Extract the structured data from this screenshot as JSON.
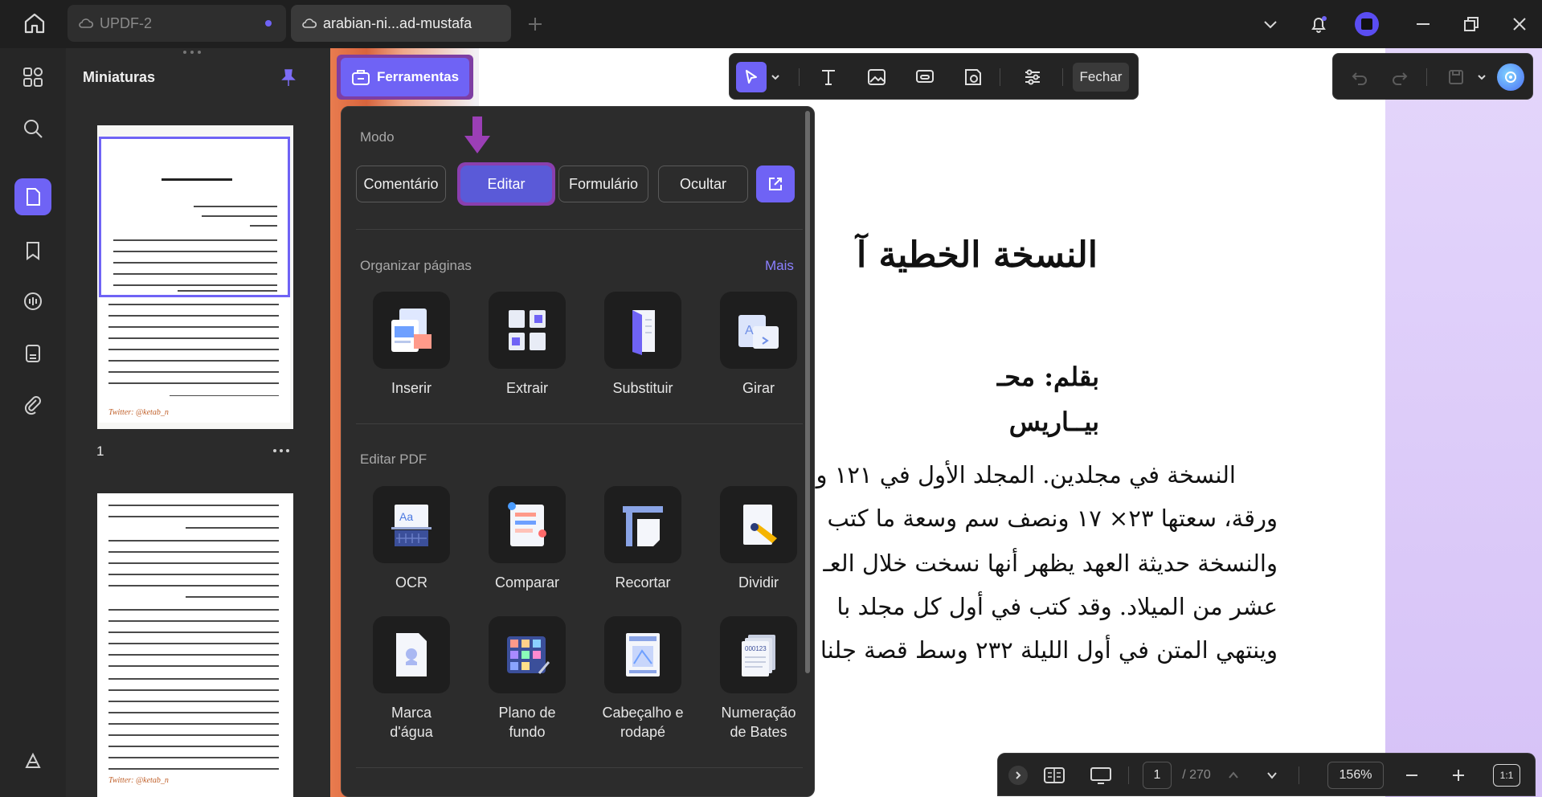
{
  "tabs": [
    {
      "label": "UPDF-2"
    },
    {
      "label": "arabian-ni...ad-mustafa"
    }
  ],
  "sidebar": {
    "title": "Miniaturas",
    "page1_number": "1",
    "thumb_sig": "Twitter: @ketab_n",
    "thumb_title": "النسخة الخطية ا (*)"
  },
  "toolbar": {
    "tools_label": "Ferramentas",
    "close_label": "Fechar"
  },
  "popup": {
    "mode_label": "Modo",
    "modes": [
      "Comentário",
      "Editar",
      "Formulário",
      "Ocultar"
    ],
    "organize_label": "Organizar páginas",
    "more_label": "Mais",
    "organize_tools": [
      "Inserir",
      "Extrair",
      "Substituir",
      "Girar"
    ],
    "edit_label": "Editar PDF",
    "edit_tools": [
      "OCR",
      "Comparar",
      "Recortar",
      "Dividir"
    ],
    "edit_tools2": [
      [
        "Marca",
        "d'água"
      ],
      [
        "Plano de",
        "fundo"
      ],
      [
        "Cabeçalho e",
        "rodapé"
      ],
      [
        "Numeração",
        "de Bates"
      ]
    ]
  },
  "document": {
    "title": "النسخة الخطية آ",
    "line1": "بقلم: محـ",
    "line2": "بيــاريس",
    "body": [
      "النسخة في مجلدين. المجلد الأول في ١٢١ ور",
      "ورقة، سعتها ٢٣× ١٧ ونصف سم وسعة ما كتب",
      "والنسخة حديثة العهد يظهر أنها نسخت خلال العـ",
      "عشر من الميلاد. وقد كتب في أول كل مجلد با",
      "وينتهي المتن في أول الليلة ٢٣٢ وسط قصة جلنا"
    ]
  },
  "bottombar": {
    "page_current": "1",
    "page_total": "/ 270",
    "zoom": "156%",
    "fit_label": "1:1"
  },
  "colors": {
    "accent": "#6f63f5",
    "highlight": "#8a3fae",
    "panel": "#2c2c2c"
  }
}
